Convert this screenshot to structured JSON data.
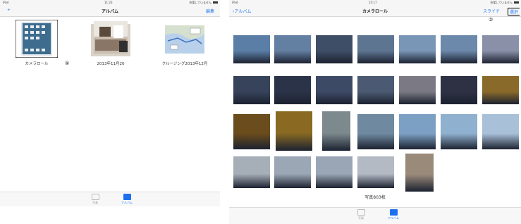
{
  "left": {
    "status": {
      "left": "iPad",
      "center": "11:23",
      "right": "充電していません"
    },
    "nav": {
      "title": "アルバム",
      "left_btn": "+",
      "right_btn": "編集"
    },
    "albums": [
      {
        "label": "カメラロール",
        "marker": "①"
      },
      {
        "label": "2013年11月20"
      },
      {
        "label": "クルージング2013年12月"
      }
    ],
    "tabs": [
      {
        "label": "写真"
      },
      {
        "label": "アルバム"
      }
    ]
  },
  "right": {
    "status": {
      "left": "iPad",
      "center": "15:17",
      "right": "充電していません"
    },
    "nav": {
      "back": "アルバム",
      "title": "カメラロール",
      "slideshow": "スライド",
      "select": "選択",
      "marker": "②"
    },
    "photo_count": "写真803枚",
    "tabs": [
      {
        "label": "写真"
      },
      {
        "label": "アルバム"
      }
    ]
  },
  "photos": {
    "row1": [
      "#5b7ea6",
      "#637fa2",
      "#3f4e67",
      "#5e7592",
      "#7a96b6",
      "#6c88aa",
      "#8a90a8"
    ],
    "row2": [
      "#36435a",
      "#2a3348",
      "#3d4a66",
      "#4b5a72",
      "#7b7a84",
      "#2e3144",
      "#8a6a2a"
    ],
    "row3": [
      "#6b4c1c",
      "#8a6a22",
      "#7c8a8e",
      "#6f8aa0",
      "#7ca0c4",
      "#8fb0ce",
      "#a8c0d8"
    ],
    "row4": [
      "#a6afb8",
      "#9ba7b5",
      "#9aa6b6",
      "#b4bac4",
      "#9a8a7a"
    ]
  }
}
